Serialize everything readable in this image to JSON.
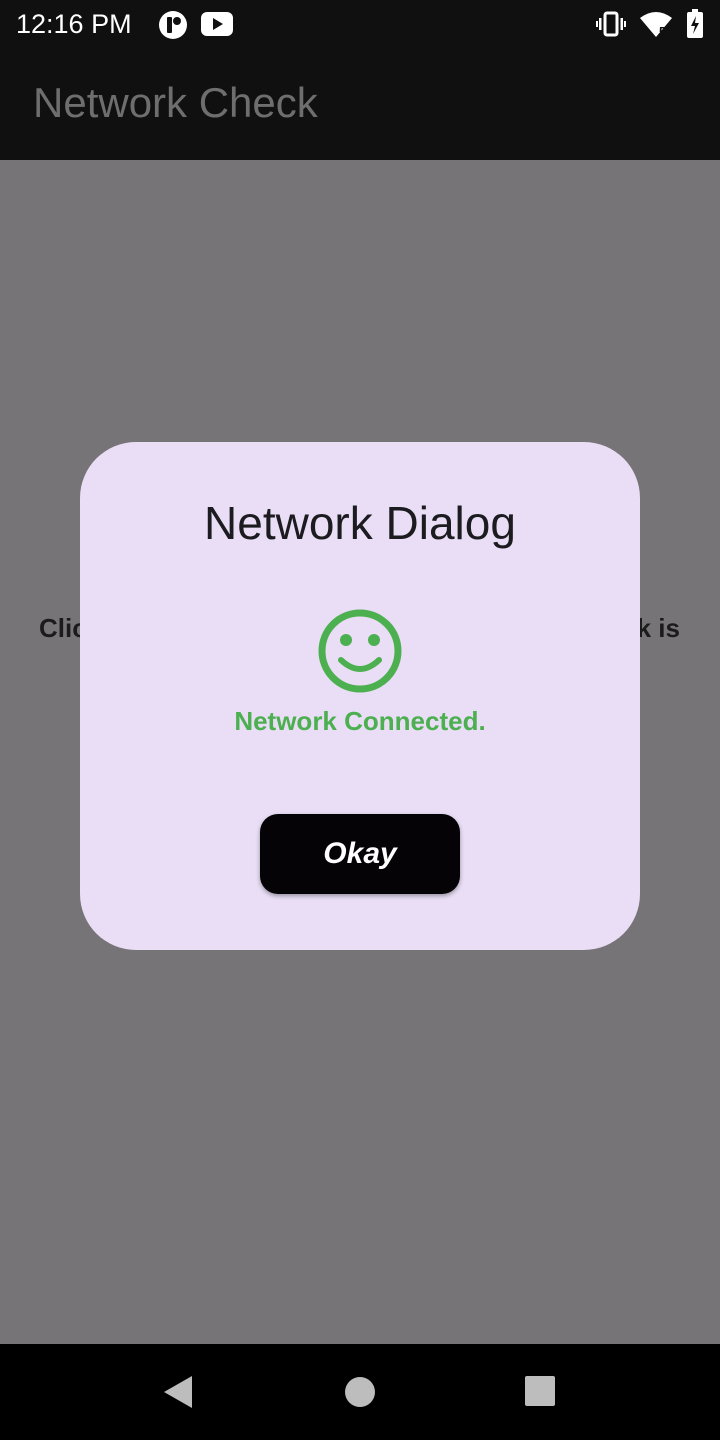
{
  "status_bar": {
    "time": "12:16 PM",
    "icons": [
      "app-notification-icon",
      "youtube-icon",
      "vibrate-icon",
      "wifi-icon",
      "battery-charging-icon"
    ],
    "wifi_badge": "5"
  },
  "app_bar": {
    "title": "Network Check"
  },
  "background": {
    "text_left": "Clic",
    "text_right": "k is"
  },
  "dialog": {
    "title": "Network Dialog",
    "icon": "smiley-icon",
    "message": "Network Connected.",
    "button_label": "Okay",
    "colors": {
      "background": "#e9def5",
      "message": "#4caf50",
      "button": "#050306"
    }
  },
  "nav_bar": {
    "icons": [
      "back-icon",
      "home-icon",
      "recents-icon"
    ]
  }
}
